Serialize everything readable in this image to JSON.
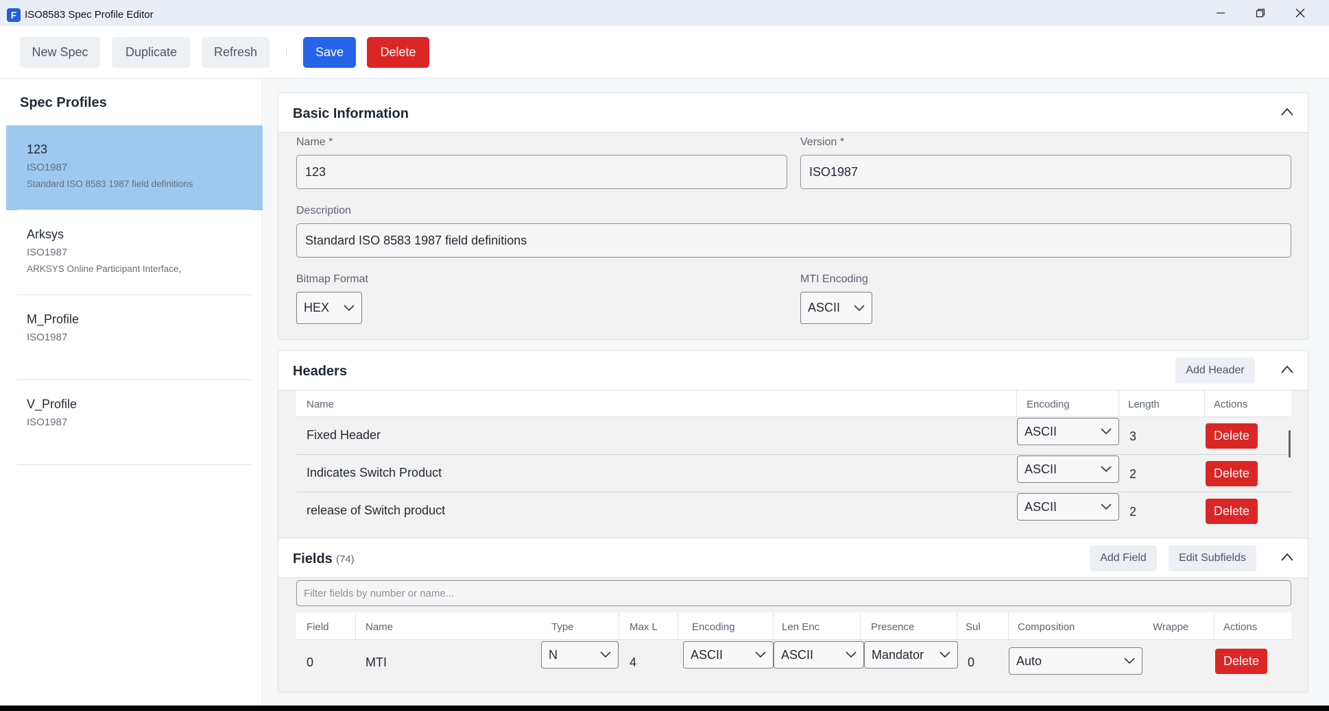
{
  "window": {
    "app_icon_letter": "F",
    "title": "ISO8583 Spec Profile Editor"
  },
  "toolbar": {
    "new_spec": "New Spec",
    "duplicate": "Duplicate",
    "refresh": "Refresh",
    "save": "Save",
    "delete": "Delete"
  },
  "sidebar": {
    "title": "Spec Profiles",
    "items": [
      {
        "name": "123",
        "version": "ISO1987",
        "description": "Standard ISO 8583 1987 field definitions",
        "selected": true
      },
      {
        "name": "Arksys",
        "version": "ISO1987",
        "description": "ARKSYS Online Participant Interface,"
      },
      {
        "name": "M_Profile",
        "version": "ISO1987",
        "description": ""
      },
      {
        "name": "V_Profile",
        "version": "ISO1987",
        "description": ""
      }
    ]
  },
  "basic": {
    "title": "Basic Information",
    "name_label": "Name *",
    "name_value": "123",
    "version_label": "Version *",
    "version_value": "ISO1987",
    "description_label": "Description",
    "description_value": "Standard ISO 8583 1987 field definitions",
    "bitmap_label": "Bitmap Format",
    "bitmap_value": "HEX",
    "mti_label": "MTI Encoding",
    "mti_value": "ASCII"
  },
  "headers": {
    "title": "Headers",
    "add_button": "Add Header",
    "columns": {
      "name": "Name",
      "encoding": "Encoding",
      "length": "Length",
      "actions": "Actions"
    },
    "rows": [
      {
        "name": "Fixed Header",
        "encoding": "ASCII",
        "length": "3",
        "action": "Delete"
      },
      {
        "name": "Indicates Switch Product",
        "encoding": "ASCII",
        "length": "2",
        "action": "Delete"
      },
      {
        "name": "release of Switch product",
        "encoding": "ASCII",
        "length": "2",
        "action": "Delete"
      }
    ]
  },
  "fields": {
    "title": "Fields",
    "count": "(74)",
    "add_button": "Add Field",
    "edit_subfields_button": "Edit Subfields",
    "filter_placeholder": "Filter fields by number or name...",
    "columns": {
      "field": "Field",
      "name": "Name",
      "type": "Type",
      "max_len": "Max L",
      "encoding": "Encoding",
      "len_enc": "Len Enc",
      "presence": "Presence",
      "sub": "Sul",
      "composition": "Composition",
      "wrapper": "Wrappe",
      "actions": "Actions"
    },
    "rows": [
      {
        "field": "0",
        "name": "MTI",
        "type": "N",
        "max_len": "4",
        "encoding": "ASCII",
        "len_enc": "ASCII",
        "presence": "Mandator",
        "sub": "0",
        "composition": "Auto",
        "action": "Delete"
      }
    ]
  },
  "colors": {
    "accent": "#2563eb",
    "danger": "#dc2626",
    "selected": "#9ec8ee"
  }
}
